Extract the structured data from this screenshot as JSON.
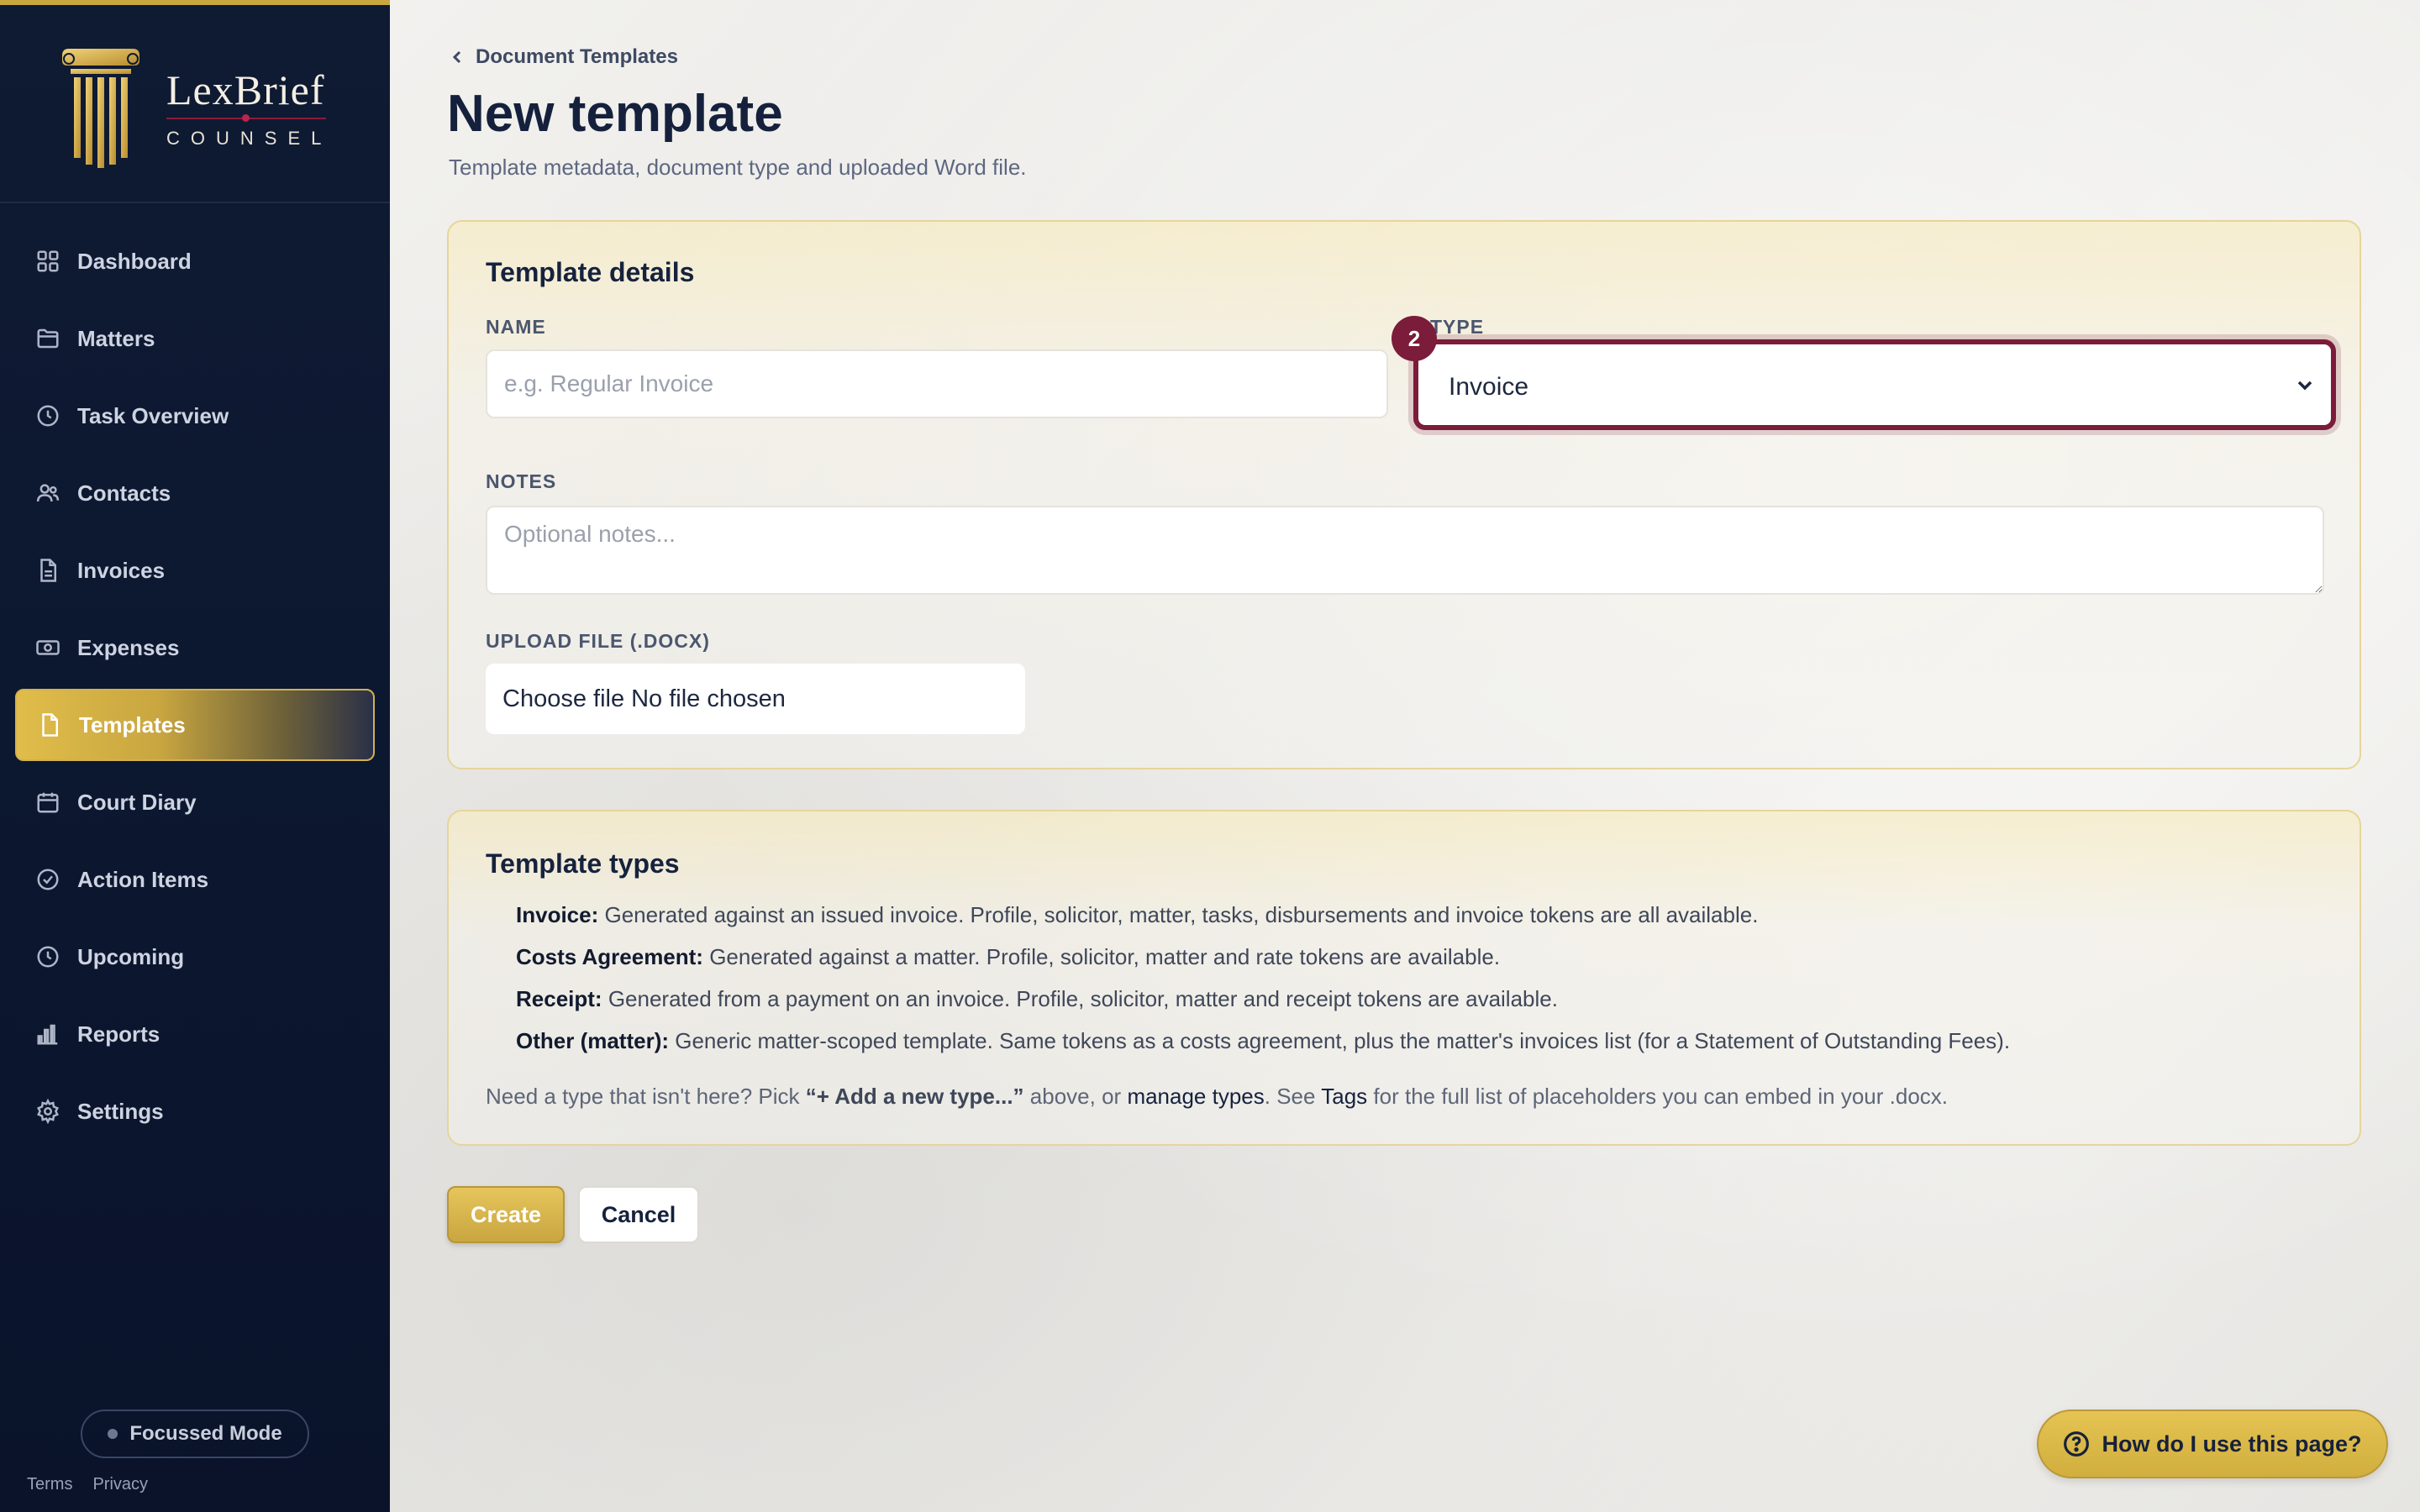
{
  "brand": {
    "name": "LexBrief",
    "subtitle": "COUNSEL"
  },
  "sidebar": {
    "items": [
      {
        "label": "Dashboard",
        "icon": "grid-icon"
      },
      {
        "label": "Matters",
        "icon": "folder-icon"
      },
      {
        "label": "Task Overview",
        "icon": "clock-icon"
      },
      {
        "label": "Contacts",
        "icon": "users-icon"
      },
      {
        "label": "Invoices",
        "icon": "file-icon"
      },
      {
        "label": "Expenses",
        "icon": "banknote-icon"
      },
      {
        "label": "Templates",
        "icon": "file-icon",
        "active": true
      },
      {
        "label": "Court Diary",
        "icon": "calendar-icon"
      },
      {
        "label": "Action Items",
        "icon": "check-circle-icon"
      },
      {
        "label": "Upcoming",
        "icon": "clock-icon"
      },
      {
        "label": "Reports",
        "icon": "bar-chart-icon"
      },
      {
        "label": "Settings",
        "icon": "gear-icon"
      }
    ],
    "focus_mode_label": "Focussed Mode",
    "footer": {
      "terms": "Terms",
      "privacy": "Privacy"
    }
  },
  "header": {
    "breadcrumb": "Document Templates",
    "title": "New template",
    "subtitle": "Template metadata, document type and uploaded Word file."
  },
  "details": {
    "title": "Template details",
    "name_label": "NAME",
    "name_placeholder": "e.g. Regular Invoice",
    "type_label": "TYPE",
    "type_value": "Invoice",
    "step_badge": "2",
    "notes_label": "NOTES",
    "notes_placeholder": "Optional notes...",
    "upload_label": "UPLOAD FILE (.DOCX)",
    "upload_button": "Choose file",
    "upload_status": "No file chosen"
  },
  "types": {
    "title": "Template types",
    "items": [
      {
        "name": "Invoice:",
        "desc": "Generated against an issued invoice. Profile, solicitor, matter, tasks, disbursements and invoice tokens are all available."
      },
      {
        "name": "Costs Agreement:",
        "desc": "Generated against a matter. Profile, solicitor, matter and rate tokens are available."
      },
      {
        "name": "Receipt:",
        "desc": "Generated from a payment on an invoice. Profile, solicitor, matter and receipt tokens are available."
      },
      {
        "name": "Other (matter):",
        "desc": "Generic matter-scoped template. Same tokens as a costs agreement, plus the matter's invoices list (for a Statement of Outstanding Fees)."
      }
    ],
    "help_prefix": "Need a type that isn't here? Pick",
    "help_add": "“+ Add a new type...”",
    "help_mid": "above, or",
    "help_manage": "manage types",
    "help_see": ". See",
    "help_tags": "Tags",
    "help_suffix": "for the full list of placeholders you can embed in your .docx."
  },
  "actions": {
    "create": "Create",
    "cancel": "Cancel"
  },
  "help_button": "How do I use this page?",
  "colors": {
    "accent_gold": "#c9a640",
    "accent_burgundy": "#7b1c3a",
    "sidebar_bg": "#0f1a33"
  }
}
